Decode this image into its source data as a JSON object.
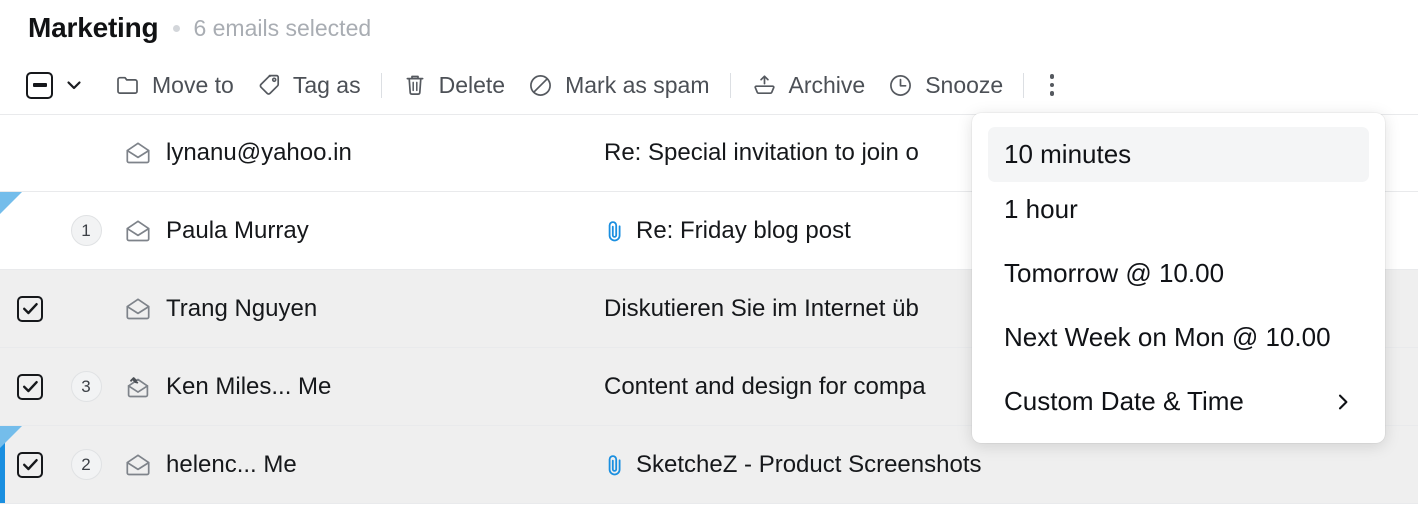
{
  "header": {
    "folder_title": "Marketing",
    "separator_icon": "dot-separator",
    "selection_count": "6 emails selected"
  },
  "toolbar": {
    "select_all_checkbox": {
      "state": "indeterminate",
      "icon": "indeterminate-checkbox-icon"
    },
    "select_caret_icon": "chevron-down-icon",
    "items": [
      {
        "label": "Move to",
        "icon": "folder-icon"
      },
      {
        "label": "Tag as",
        "icon": "tag-icon"
      },
      {
        "label": "Delete",
        "icon": "trash-icon"
      },
      {
        "label": "Mark as spam",
        "icon": "no-entry-icon"
      },
      {
        "label": "Archive",
        "icon": "archive-icon"
      },
      {
        "label": "Snooze",
        "icon": "clock-icon"
      }
    ],
    "overflow_icon": "kebab-menu-icon"
  },
  "list": {
    "rows": [
      {
        "selected": false,
        "checkbox_visible": false,
        "count": "",
        "envelope_icon": "envelope-open-icon",
        "sender": "lynanu@yahoo.in",
        "subject": "Re: Special invitation to join o",
        "has_attachment": false,
        "flagged_corner": false,
        "left_stripe": false
      },
      {
        "selected": false,
        "checkbox_visible": false,
        "count": "1",
        "envelope_icon": "envelope-open-icon",
        "sender": "Paula Murray",
        "subject": "Re: Friday blog post",
        "has_attachment": true,
        "flagged_corner": true,
        "left_stripe": false
      },
      {
        "selected": true,
        "checkbox_visible": true,
        "count": "",
        "envelope_icon": "envelope-open-icon",
        "sender": "Trang Nguyen",
        "subject": "Diskutieren Sie im Internet üb",
        "has_attachment": false,
        "flagged_corner": false,
        "left_stripe": false
      },
      {
        "selected": true,
        "checkbox_visible": true,
        "count": "3",
        "envelope_icon": "envelope-reply-icon",
        "sender": "Ken Miles... Me",
        "subject": "Content and design for compa",
        "has_attachment": false,
        "flagged_corner": false,
        "left_stripe": false
      },
      {
        "selected": true,
        "checkbox_visible": true,
        "count": "2",
        "envelope_icon": "envelope-open-icon",
        "sender": "helenc... Me",
        "subject": "SketcheZ - Product Screenshots",
        "has_attachment": true,
        "flagged_corner": true,
        "left_stripe": true
      }
    ]
  },
  "snooze_menu": {
    "items": [
      {
        "label": "10 minutes",
        "active": true,
        "submenu": false
      },
      {
        "label": "1 hour",
        "active": false,
        "submenu": false
      },
      {
        "label": "Tomorrow @ 10.00",
        "active": false,
        "submenu": false
      },
      {
        "label": "Next Week on Mon @ 10.00",
        "active": false,
        "submenu": false
      },
      {
        "label": "Custom Date & Time",
        "active": false,
        "submenu": true,
        "submenu_icon": "chevron-right-icon"
      }
    ]
  },
  "colors": {
    "accent_blue": "#1a8fe0",
    "flag_blue": "#74bdeb",
    "attachment_blue": "#1a8fe0",
    "selected_row_bg": "#efefef",
    "text_primary": "#16181b",
    "text_muted": "#a9adb3"
  }
}
